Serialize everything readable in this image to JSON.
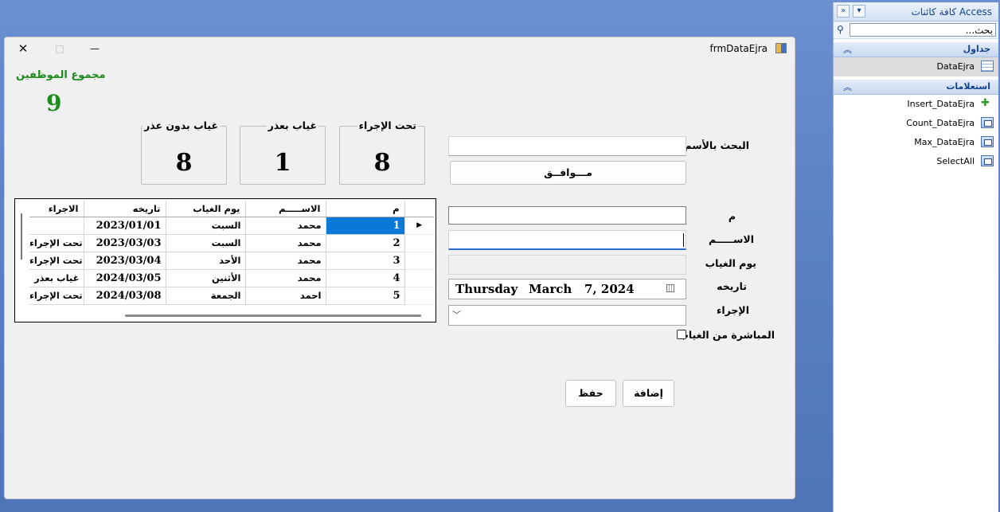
{
  "nav": {
    "title": "كافة كائنات Access",
    "search_placeholder": "بحث...",
    "groups": [
      {
        "label": "جداول",
        "items": [
          {
            "label": "DataEjra",
            "selected": true
          }
        ]
      },
      {
        "label": "استعلامات",
        "items": [
          {
            "label": "Insert_DataEjra"
          },
          {
            "label": "Count_DataEjra"
          },
          {
            "label": "Max_DataEjra"
          },
          {
            "label": "SelectAll"
          }
        ]
      }
    ]
  },
  "window": {
    "title": "frmDataEjra",
    "close": "✕",
    "maximize": "□",
    "minimize": "—"
  },
  "total": {
    "label": "مجموع الموظفين",
    "value": "9"
  },
  "stats": [
    {
      "label": "تحت الإجراء",
      "value": "8"
    },
    {
      "label": "غياب بعذر",
      "value": "1"
    },
    {
      "label": "غياب بدون عذر",
      "value": "8"
    }
  ],
  "search": {
    "label": "البحث بالأسم",
    "value": "",
    "ok_button": "مـــوافــق"
  },
  "fields": {
    "id_label": "م",
    "name_label": "الاســـــم",
    "day_label": "يوم الغياب",
    "date_label": "تاريخه",
    "action_label": "الإجراء",
    "return_label": "المباشرة من الغياب",
    "date": {
      "weekday": "Thursday",
      "sep": ",",
      "month": "March",
      "day_year": "7, 2024"
    }
  },
  "buttons": {
    "save": "حفظ",
    "add": "إضافة"
  },
  "grid": {
    "columns": [
      "الاجراء",
      "تاريخه",
      "يوم الغياب",
      "الاســـــم",
      "م"
    ],
    "rows": [
      [
        "",
        "2023/01/01",
        "السبت",
        "محمد",
        "1"
      ],
      [
        "تحت الإجراء",
        "2023/03/03",
        "السبت",
        "محمد",
        "2"
      ],
      [
        "تحت الإجراء",
        "2023/03/04",
        "الأحد",
        "محمد",
        "3"
      ],
      [
        "غياب بعذر",
        "2024/03/05",
        "الأثنين",
        "محمد",
        "4"
      ],
      [
        "تحت الإجراء",
        "2024/03/08",
        "الجمعة",
        "احمد",
        "5"
      ]
    ],
    "current_row_marker": "▶"
  }
}
